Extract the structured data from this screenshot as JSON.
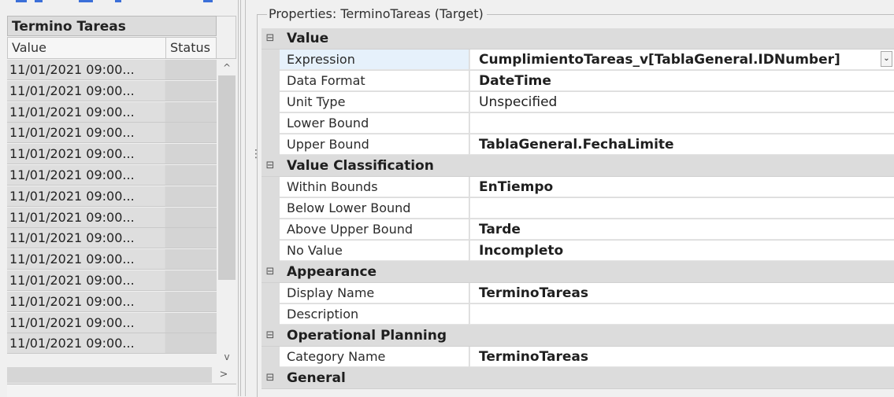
{
  "left_panel": {
    "grid_title": "Termino Tareas",
    "columns": [
      "Value",
      "Status"
    ],
    "rows": [
      "11/01/2021 09:00...",
      "11/01/2021 09:00...",
      "11/01/2021 09:00...",
      "11/01/2021 09:00...",
      "11/01/2021 09:00...",
      "11/01/2021 09:00...",
      "11/01/2021 09:00...",
      "11/01/2021 09:00...",
      "11/01/2021 09:00...",
      "11/01/2021 09:00...",
      "11/01/2021 09:00...",
      "11/01/2021 09:00...",
      "11/01/2021 09:00...",
      "11/01/2021 09:00..."
    ],
    "scroll_up_glyph": "^",
    "scroll_down_glyph": "v",
    "scroll_right_glyph": ">"
  },
  "splitter": {
    "grip_glyph": "⋮"
  },
  "properties": {
    "title": "Properties: TerminoTareas (Target)",
    "collapse_glyph": "⊟",
    "dropdown_glyph": "⌄",
    "categories": [
      {
        "label": "Value",
        "rows": [
          {
            "name": "Expression",
            "value": "CumplimientoTareas_v[TablaGeneral.IDNumber]",
            "bold": true
          },
          {
            "name": "Data Format",
            "value": "DateTime",
            "bold": true
          },
          {
            "name": "Unit Type",
            "value": "Unspecified",
            "bold": false
          },
          {
            "name": "Lower Bound",
            "value": "",
            "bold": false
          },
          {
            "name": "Upper Bound",
            "value": "TablaGeneral.FechaLimite",
            "bold": true
          }
        ]
      },
      {
        "label": "Value Classification",
        "rows": [
          {
            "name": "Within Bounds",
            "value": "EnTiempo",
            "bold": true
          },
          {
            "name": "Below Lower Bound",
            "value": "",
            "bold": false
          },
          {
            "name": "Above Upper Bound",
            "value": "Tarde",
            "bold": true
          },
          {
            "name": "No Value",
            "value": "Incompleto",
            "bold": true
          }
        ]
      },
      {
        "label": "Appearance",
        "rows": [
          {
            "name": "Display Name",
            "value": "TerminoTareas",
            "bold": true
          },
          {
            "name": "Description",
            "value": "",
            "bold": false
          }
        ]
      },
      {
        "label": "Operational Planning",
        "rows": [
          {
            "name": "Category Name",
            "value": "TerminoTareas",
            "bold": true
          }
        ]
      },
      {
        "label": "General",
        "rows": []
      }
    ]
  },
  "colors": {
    "background": "#f0f0f0",
    "category_band": "#dcdcdc",
    "selected_row": "#e6f1fb",
    "link_fragment": "#3b6fd8"
  }
}
